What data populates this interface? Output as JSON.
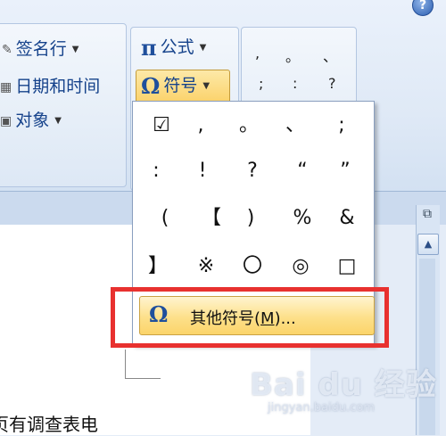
{
  "ribbon": {
    "signature_label": "签名行",
    "datetime_label": "日期和时间",
    "object_label": "对象",
    "formula_label": "公式",
    "symbol_label": "符号",
    "help_label": "?"
  },
  "quick_symbols": [
    ",",
    "。",
    "、",
    ";",
    ":",
    "?"
  ],
  "symbol_grid": [
    "☑",
    ",",
    "。",
    "、",
    ";",
    ":",
    "!",
    "?",
    "“",
    "”",
    "(",
    "【",
    ")",
    "%",
    "&",
    "】",
    "※",
    "〇",
    "◎",
    "□"
  ],
  "other_symbols": {
    "label_main": "其他符号(",
    "label_key": "M",
    "label_end": ")..."
  },
  "document": {
    "partial_text": "页有调查表电"
  },
  "watermark": {
    "main": "Bai du 经验",
    "sub": "jingyan.baidu.com"
  },
  "colors": {
    "accent_blue": "#15428b",
    "highlight_red": "#e8312f",
    "hover_gold": "#fbd46a"
  }
}
